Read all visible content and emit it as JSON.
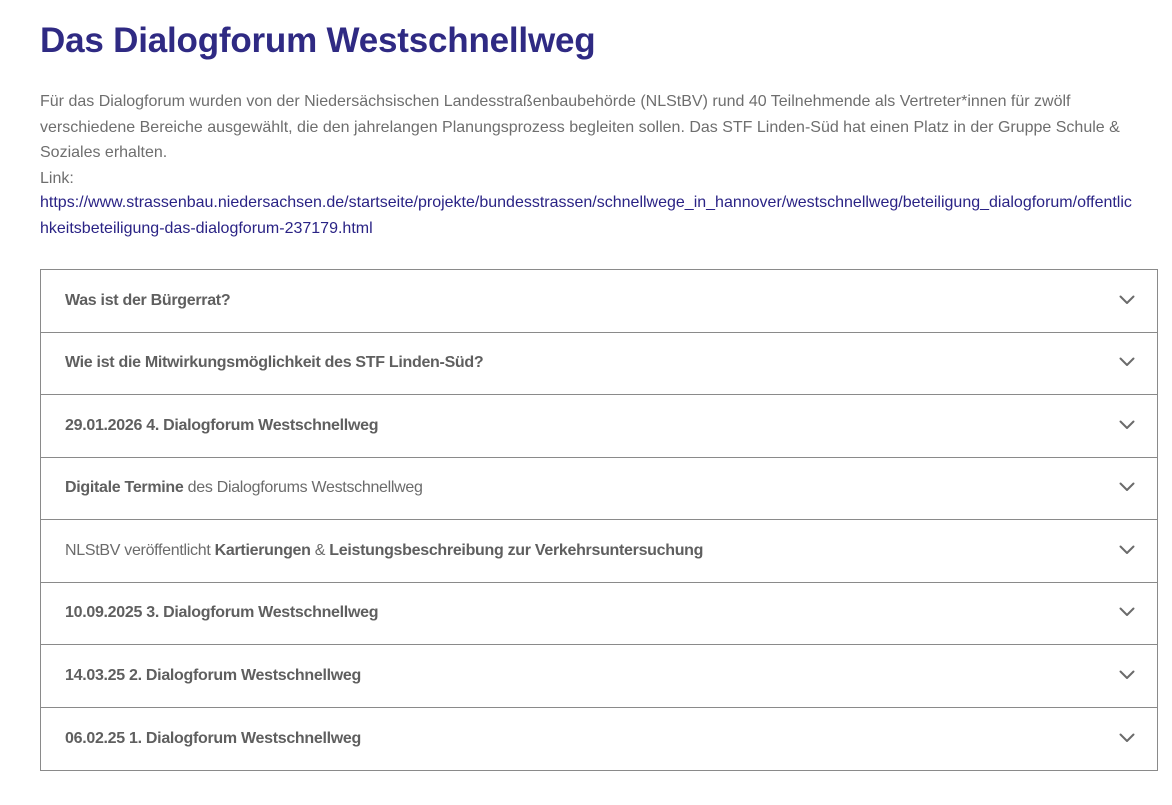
{
  "page": {
    "title": "Das Dialogforum Westschnellweg",
    "intro": "Für das Dialogforum wurden von der Niedersächsischen Landesstraßenbaubehörde (NLStBV) rund 40 Teilnehmende als Vertreter*innen für zwölf verschiedene Bereiche ausgewählt, die den jahrelangen Planungsprozess begleiten sollen. Das STF Linden-Süd hat einen Platz in der Gruppe Schule & Soziales erhalten.",
    "link_label": "Link:",
    "link_text": "https://www.strassenbau.niedersachsen.de/startseite/projekte/bundesstrassen/schnellwege_in_hannover/westschnellweg/beteiligung_dialogforum/offentlichkeitsbeteiligung-das-dialogforum-237179.html"
  },
  "accordion": {
    "icon": "chevron-down-icon",
    "items": [
      {
        "parts": [
          {
            "text": "Was ist der Bürgerrat?",
            "bold": true
          }
        ]
      },
      {
        "parts": [
          {
            "text": "Wie ist die Mitwirkungsmöglichkeit des STF Linden-Süd?",
            "bold": true
          }
        ]
      },
      {
        "parts": [
          {
            "text": "29.01.2026 4. Dialogforum Westschnellweg",
            "bold": true
          }
        ]
      },
      {
        "parts": [
          {
            "text": "Digitale Termine",
            "bold": true
          },
          {
            "text": " des Dialogforums Westschnellweg",
            "bold": false
          }
        ]
      },
      {
        "parts": [
          {
            "text": "NLStBV veröffentlicht ",
            "bold": false
          },
          {
            "text": "Kartierungen",
            "bold": true
          },
          {
            "text": " & ",
            "bold": false
          },
          {
            "text": "Leistungsbeschreibung zur Verkehrsuntersuchung",
            "bold": true
          }
        ]
      },
      {
        "parts": [
          {
            "text": "10.09.2025 3. Dialogforum Westschnellweg",
            "bold": true
          }
        ]
      },
      {
        "parts": [
          {
            "text": "14.03.25 2. Dialogforum Westschnellweg",
            "bold": true
          }
        ]
      },
      {
        "parts": [
          {
            "text": "06.02.25 1. Dialogforum Westschnellweg",
            "bold": true
          }
        ]
      }
    ]
  }
}
